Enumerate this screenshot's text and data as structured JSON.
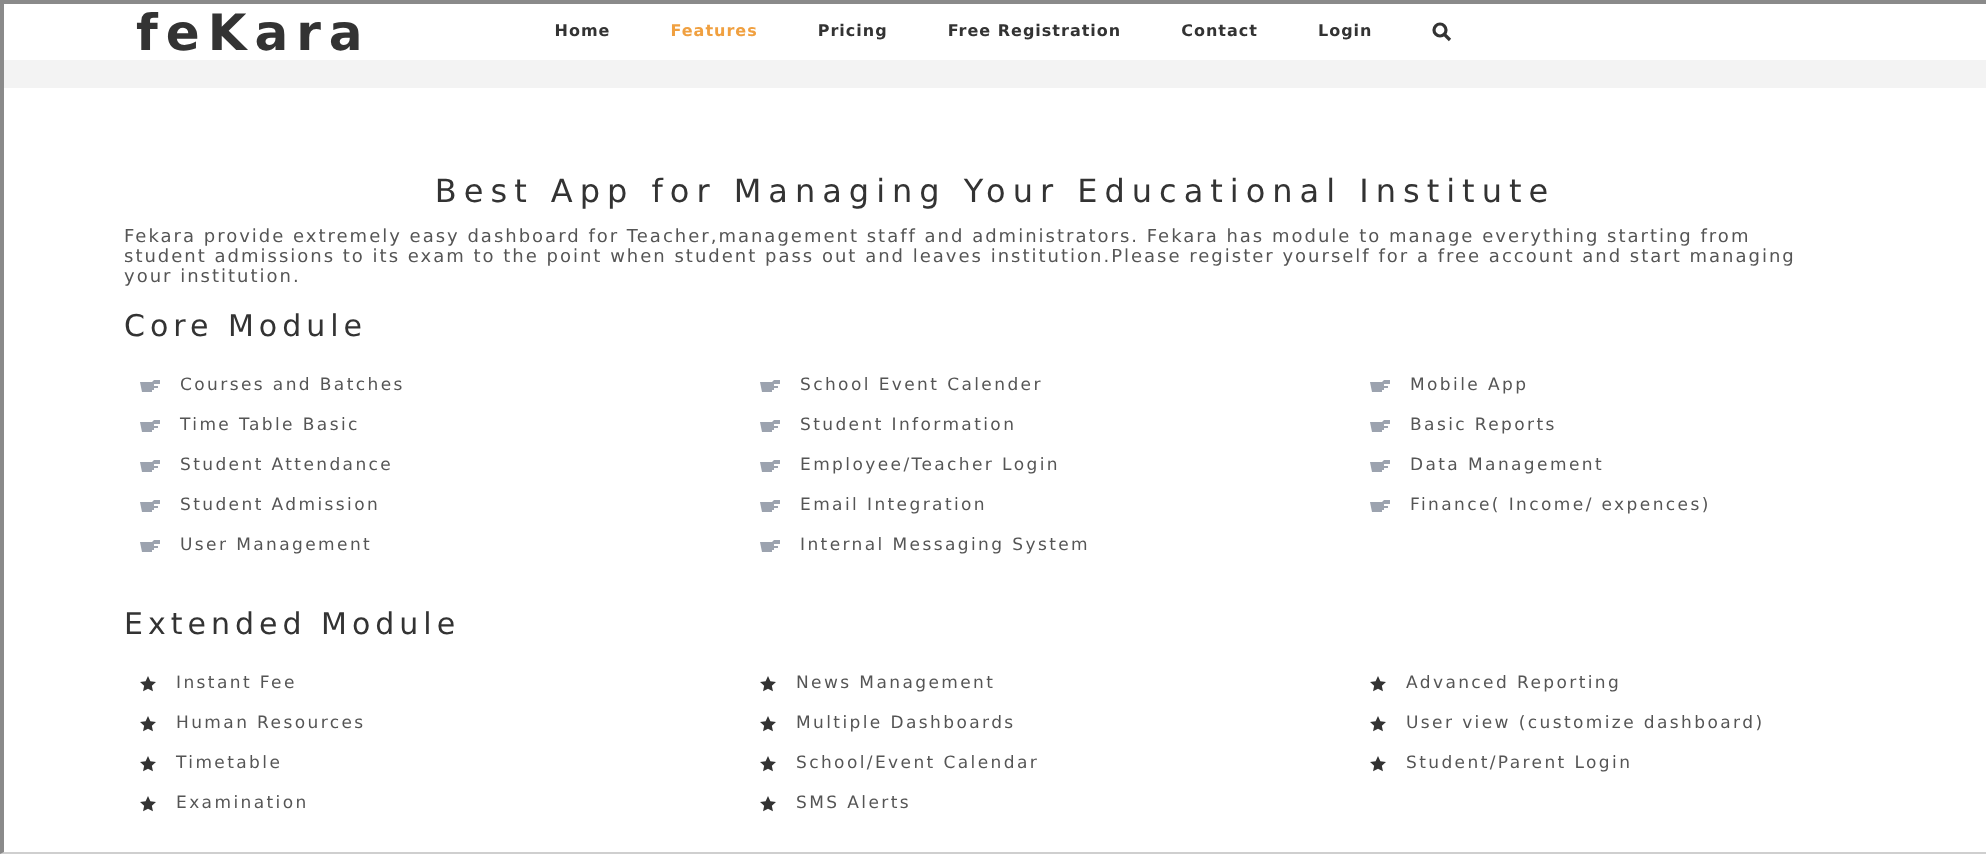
{
  "header": {
    "logo": "feKara",
    "nav": [
      {
        "label": "Home",
        "selected": false
      },
      {
        "label": "Features",
        "selected": true
      },
      {
        "label": "Pricing",
        "selected": false
      },
      {
        "label": "Free Registration",
        "selected": false
      },
      {
        "label": "Contact",
        "selected": false
      },
      {
        "label": "Login",
        "selected": false
      }
    ]
  },
  "title": "Best App for Managing Your Educational Institute",
  "description": "Fekara provide extremely easy dashboard for Teacher,management staff and administrators. Fekara has module to manage everything starting from student admissions to its exam to the point when student pass out and leaves institution.Please register yourself for a free account and start managing your institution.",
  "sections": [
    {
      "heading": "Core Module",
      "kind": "hand",
      "items": [
        "Courses and Batches",
        "School Event Calender",
        "Mobile App",
        "Time Table Basic",
        "Student Information",
        "Basic Reports",
        "Student Attendance",
        "Employee/Teacher Login",
        "Data Management",
        "Student Admission",
        "Email Integration",
        "Finance( Income/ expences)",
        "User Management",
        "Internal Messaging System"
      ]
    },
    {
      "heading": "Extended Module",
      "kind": "star",
      "items": [
        "Instant Fee",
        "News Management",
        "Advanced Reporting",
        "Human Resources",
        "Multiple Dashboards",
        "User view (customize dashboard)",
        "Timetable",
        "School/Event Calendar",
        "Student/Parent Login",
        "Examination",
        "SMS Alerts"
      ]
    }
  ]
}
